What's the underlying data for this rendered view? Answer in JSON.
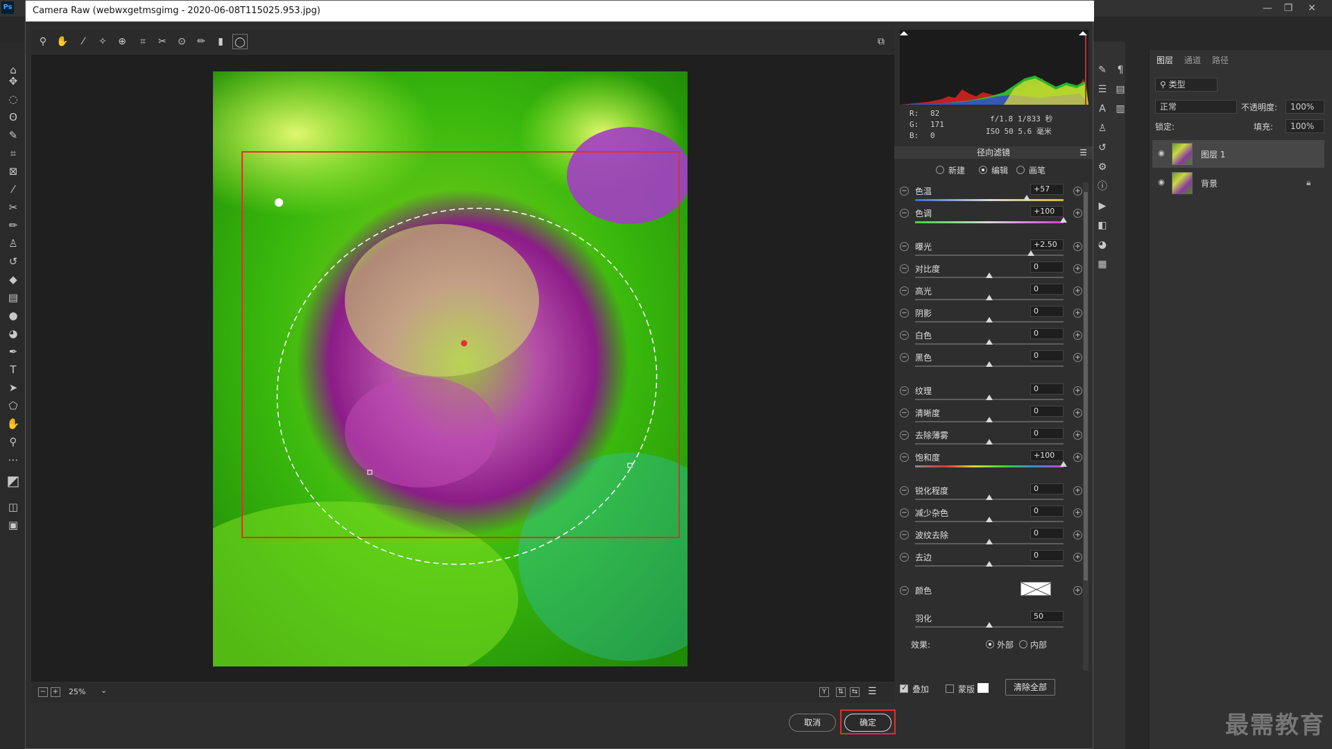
{
  "app": {
    "logo": "Ps",
    "window_buttons": [
      "—",
      "❐",
      "✕"
    ]
  },
  "dialog": {
    "title": "Camera Raw (webwxgetmsgimg - 2020-06-08T115025.953.jpg)",
    "zoom": "25%",
    "cancel_label": "取消",
    "ok_label": "确定"
  },
  "info": {
    "r_label": "R:",
    "r_value": "82",
    "g_label": "G:",
    "g_value": "171",
    "b_label": "B:",
    "b_value": "0",
    "exposure_info": "f/1.8  1/833 秒",
    "iso_info": "ISO 50  5.6 毫米"
  },
  "panel": {
    "title": "径向滤镜",
    "modes": [
      {
        "label": "新建",
        "selected": false
      },
      {
        "label": "编辑",
        "selected": true
      },
      {
        "label": "画笔",
        "selected": false
      }
    ],
    "sliders": [
      {
        "label": "色温",
        "value": "+57",
        "fraction": 0.75
      },
      {
        "label": "色调",
        "value": "+100",
        "fraction": 1.0
      },
      {
        "label": "曝光",
        "value": "+2.50",
        "fraction": 0.78
      },
      {
        "label": "对比度",
        "value": "0",
        "fraction": 0.5
      },
      {
        "label": "高光",
        "value": "0",
        "fraction": 0.5
      },
      {
        "label": "阴影",
        "value": "0",
        "fraction": 0.5
      },
      {
        "label": "白色",
        "value": "0",
        "fraction": 0.5
      },
      {
        "label": "黑色",
        "value": "0",
        "fraction": 0.5
      },
      {
        "label": "纹理",
        "value": "0",
        "fraction": 0.5
      },
      {
        "label": "清晰度",
        "value": "0",
        "fraction": 0.5
      },
      {
        "label": "去除薄雾",
        "value": "0",
        "fraction": 0.5
      },
      {
        "label": "饱和度",
        "value": "+100",
        "fraction": 1.0
      },
      {
        "label": "锐化程度",
        "value": "0",
        "fraction": 0.5
      },
      {
        "label": "减少杂色",
        "value": "0",
        "fraction": 0.5
      },
      {
        "label": "波纹去除",
        "value": "0",
        "fraction": 0.5
      },
      {
        "label": "去边",
        "value": "0",
        "fraction": 0.5
      }
    ],
    "color_label": "颜色",
    "feather_label": "羽化",
    "feather_value": "50",
    "feather_fraction": 0.5,
    "effect_label": "效果:",
    "effect_outer": "外部",
    "effect_inner": "内部",
    "overlay_label": "叠加",
    "mask_label": "蒙版",
    "clear_all_label": "清除全部"
  },
  "layers_panel": {
    "tabs": [
      "图层",
      "通道",
      "路径"
    ],
    "filter_label": "类型",
    "blend_mode": "正常",
    "opacity_label": "不透明度:",
    "opacity_value": "100%",
    "lock_label": "锁定:",
    "fill_label": "填充:",
    "fill_value": "100%",
    "layers": [
      {
        "name": "图层 1",
        "selected": true
      },
      {
        "name": "背景",
        "selected": false
      }
    ]
  },
  "watermark": "最需教育",
  "colors": {
    "accent_red": "#e03030",
    "panel_bg": "#2e2e2e"
  }
}
